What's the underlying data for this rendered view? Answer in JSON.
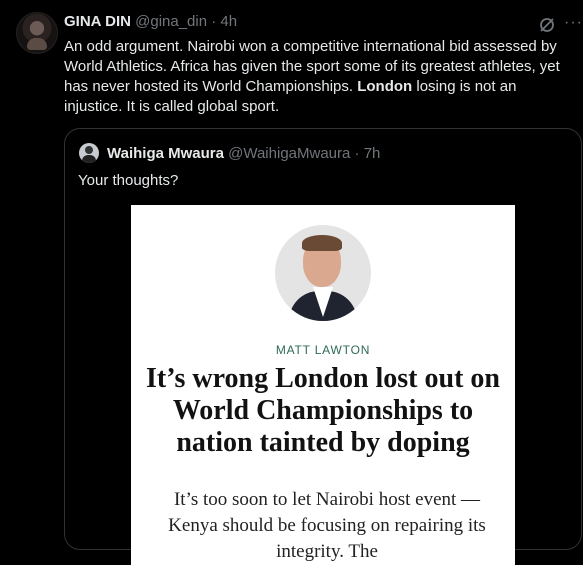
{
  "tweet": {
    "author_name": "GINA DIN",
    "handle": "@gina_din",
    "separator": "·",
    "time": "4h",
    "text_part1": "An odd argument. Nairobi won a competitive international bid assessed by World Athletics. Africa has given the sport some of its greatest athletes, yet has never hosted its World Championships. ",
    "text_bold": "London",
    "text_part2": " losing is not an injustice. It is called global sport.",
    "icons": [
      "grok-icon",
      "more-icon"
    ],
    "more_label": "···"
  },
  "quote": {
    "author_name": "Waihiga Mwaura",
    "handle": "@WaihigaMwaura",
    "separator": "·",
    "time": "7h",
    "text": "Your thoughts?",
    "article": {
      "author": "MATT LAWTON",
      "headline": "It’s wrong London lost out on World Championships to nation tainted by doping",
      "standfirst": "It’s too soon to let Nairobi host event — Kenya should be focusing on repairing its integrity. The"
    }
  },
  "colors": {
    "background": "#000000",
    "text": "#e7e9ea",
    "muted": "#71767b",
    "border": "#2f3336",
    "author_green": "#2e6b55"
  }
}
